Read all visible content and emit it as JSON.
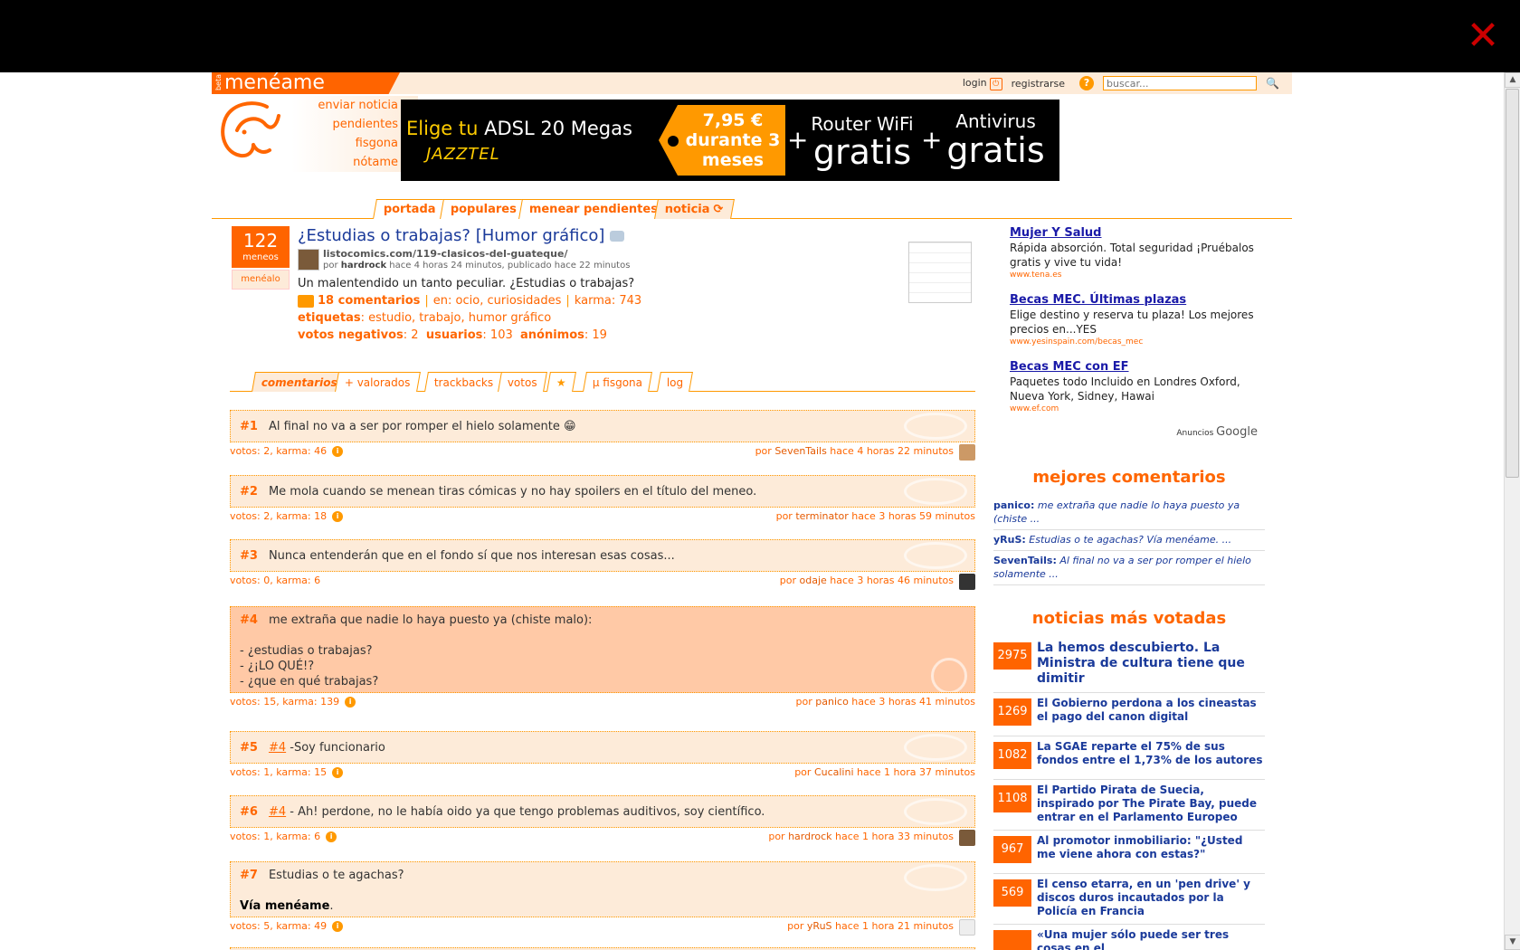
{
  "overlay": {
    "close_icon": "close-x-icon"
  },
  "header": {
    "beta": "beta",
    "logo": "menéame",
    "login": "login",
    "register": "registrarse",
    "help": "?",
    "search_placeholder": "buscar..."
  },
  "side_links": [
    "enviar noticia",
    "pendientes",
    "fisgona",
    "nótame"
  ],
  "banner": {
    "elige": "Elige tu ",
    "adsl": "ADSL 20 Megas",
    "brand": "JAZZTEL",
    "price": "7,95 €",
    "price2": "durante 3",
    "price3": "meses",
    "router1": "Router WiFi",
    "router2": "gratis",
    "anti1": "Antivirus",
    "anti2": "gratis",
    "plus": "+"
  },
  "nav": [
    "portada",
    "populares",
    "menear pendientes",
    "noticia"
  ],
  "story": {
    "votes": "122",
    "votes_label": "meneos",
    "menealo": "menéalo",
    "title": "¿Estudias o trabajas? [Humor gráfico]",
    "url": "listocomics.com/119-clasicos-del-guateque/",
    "by_prefix": "por ",
    "author": "hardrock",
    "time": " hace 4 horas 24 minutos, publicado hace 22 minutos",
    "text": "Un malentendido un tanto peculiar. ¿Estudias o trabajas?",
    "comments": "18 comentarios",
    "en_label": "en:",
    "en_value": " ocio, curiosidades",
    "karma_label": "karma:",
    "karma_value": " 743",
    "tags_label": "etiquetas",
    "tags_value": ": estudio, trabajo, humor gráfico",
    "neg_label": "votos negativos",
    "neg_value": ": 2",
    "users_label": "usuarios",
    "users_value": ": 103",
    "anon_label": "anónimos",
    "anon_value": ": 19"
  },
  "sub_tabs": [
    "comentarios",
    "+ valorados",
    "trackbacks",
    "votos",
    "★",
    "µ fisgona",
    "log"
  ],
  "comments": [
    {
      "num": "#1",
      "text": "Al final no va a ser por romper el hielo solamente 😁",
      "stats": "votos: 2, karma: 46",
      "by": "por ",
      "user": "SevenTails",
      "time": " hace 4 horas 22 minutos"
    },
    {
      "num": "#2",
      "text": "Me mola cuando se menean tiras cómicas y no hay spoilers en el título del meneo.",
      "stats": "votos: 2, karma: 18",
      "by": "por ",
      "user": "terminator",
      "time": " hace 3 horas 59 minutos"
    },
    {
      "num": "#3",
      "text": "Nunca entenderán que en el fondo sí que nos interesan esas cosas...",
      "stats": "votos: 0, karma: 6",
      "by": "por ",
      "user": "odaje",
      "time": " hace 3 horas 46 minutos"
    },
    {
      "num": "#4",
      "text": "me extraña que nadie lo haya puesto ya (chiste malo):",
      "l2": "- ¿estudias o trabajas?",
      "l3": "- ¿¡LO QUÉ!?",
      "l4": "- ¿que en qué trabajas?",
      "stats": "votos: 15, karma: 139",
      "by": "por ",
      "user": "panico",
      "time": " hace 3 horas 41 minutos"
    },
    {
      "num": "#5",
      "ref": "#4",
      "text": " -Soy funcionario",
      "stats": "votos: 1, karma: 15",
      "by": "por ",
      "user": "Cucalini",
      "time": " hace 1 hora 37 minutos"
    },
    {
      "num": "#6",
      "ref": "#4",
      "text": " - Ah! perdone, no le había oido ya que tengo problemas auditivos, soy científico.",
      "stats": "votos: 1, karma: 6",
      "by": "por ",
      "user": "hardrock",
      "time": " hace 1 hora 33 minutos"
    },
    {
      "num": "#7",
      "text": "Estudias o te agachas?",
      "l2": "Vía menéame",
      "stats": "votos: 5, karma: 49",
      "by": "por ",
      "user": "yRuS",
      "time": " hace 1 hora 21 minutos"
    }
  ],
  "ads": [
    {
      "title": "Mujer Y Salud",
      "text": "Rápida absorción. Total seguridad ¡Pruébalos gratis y vive tu vida!",
      "url": "www.tena.es"
    },
    {
      "title": "Becas MEC. Últimas plazas",
      "text": "Elige destino y reserva tu plaza! Los mejores precios en...YES",
      "url": "www.yesinspain.com/becas_mec"
    },
    {
      "title": "Becas MEC con EF",
      "text": "Paquetes todo Incluido en Londres Oxford, Nueva York, Sidney, Hawai",
      "url": "www.ef.com"
    }
  ],
  "ads_by": "Anuncios ",
  "ads_google": "Google",
  "best_title": "mejores comentarios",
  "best": [
    {
      "user": "panico:",
      "text": " me extraña que nadie lo haya puesto ya (chiste ..."
    },
    {
      "user": "yRuS:",
      "text": " Estudias o te agachas? Vía menéame. ..."
    },
    {
      "user": "SevenTails:",
      "text": " Al final no va a ser por romper el hielo solamente ..."
    }
  ],
  "top_title": "noticias más votadas",
  "top": [
    {
      "n": "2975",
      "t": "La hemos descubierto. La Ministra de cultura tiene que dimitir"
    },
    {
      "n": "1269",
      "t": "El Gobierno perdona a los cineastas el pago del canon digital"
    },
    {
      "n": "1082",
      "t": "La SGAE reparte el 75% de sus fondos entre el 1,73% de los autores"
    },
    {
      "n": "1108",
      "t": "El Partido Pirata de Suecia, inspirado por The Pirate Bay, puede entrar en el Parlamento Europeo"
    },
    {
      "n": "967",
      "t": "Al promotor inmobiliario: \"¿Usted me viene ahora con estas?\""
    },
    {
      "n": "569",
      "t": "El censo etarra, en un 'pen drive' y discos duros incautados por la Policía en Francia"
    },
    {
      "n": "",
      "t": "«Una mujer sólo puede ser tres cosas en el"
    }
  ],
  "scroll": {
    "up": "▲",
    "down": "▼"
  }
}
